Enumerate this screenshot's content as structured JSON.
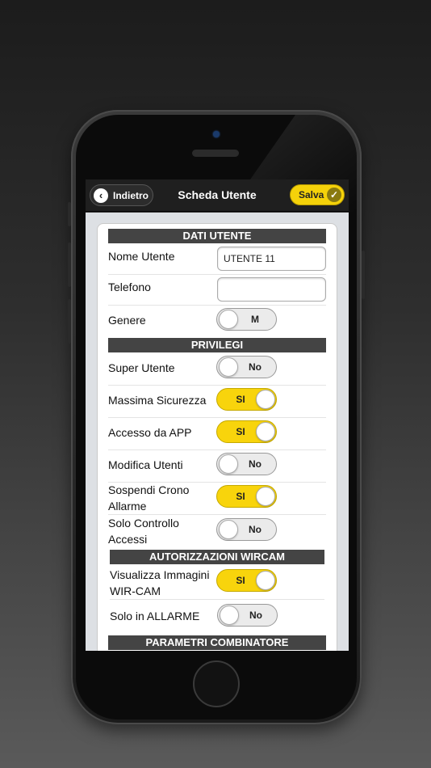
{
  "header": {
    "back_label": "Indietro",
    "title": "Scheda Utente",
    "save_label": "Salva"
  },
  "sections": {
    "dati_utente": "DATI UTENTE",
    "privilegi": "PRIVILEGI",
    "wircam": "AUTORIZZAZIONI WIRCAM",
    "combinatore": "PARAMETRI COMBINATORE"
  },
  "fields": {
    "nome_utente": {
      "label": "Nome Utente",
      "value": "UTENTE 11"
    },
    "telefono": {
      "label": "Telefono",
      "value": ""
    },
    "genere": {
      "label": "Genere",
      "value": "M"
    },
    "super_utente": {
      "label": "Super Utente",
      "value": "No"
    },
    "massima_sicurezza": {
      "label": "Massima Sicurezza",
      "value": "SI"
    },
    "accesso_app": {
      "label": "Accesso da APP",
      "value": "SI"
    },
    "modifica_utenti": {
      "label": "Modifica Utenti",
      "value": "No"
    },
    "sospendi_crono": {
      "label_1": "Sospendi Crono",
      "label_2": "Allarme",
      "value": "SI"
    },
    "solo_controllo": {
      "label_1": "Solo Controllo",
      "label_2": "Accessi",
      "value": "No"
    },
    "visualizza_immagini": {
      "label_1": "Visualizza Immagini",
      "label_2": "WIR-CAM",
      "value": "SI"
    },
    "solo_allarme": {
      "label": "Solo in ALLARME",
      "value": "No"
    }
  },
  "colors": {
    "accent": "#f8d40c",
    "section_bg": "#444444"
  }
}
